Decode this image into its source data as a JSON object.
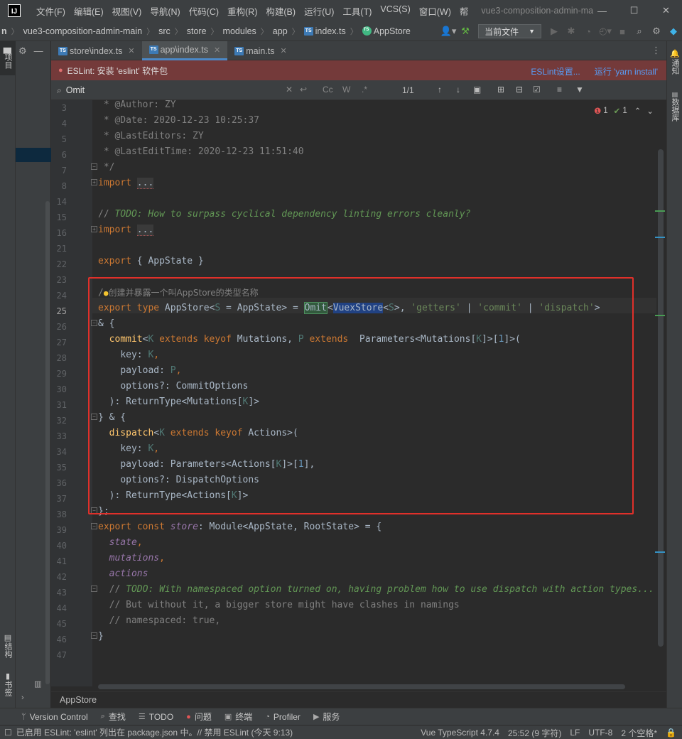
{
  "app": {
    "logo": "IJ",
    "window_title": "vue3-composition-admin-ma",
    "menu": [
      "文件(F)",
      "编辑(E)",
      "视图(V)",
      "导航(N)",
      "代码(C)",
      "重构(R)",
      "构建(B)",
      "运行(U)",
      "工具(T)",
      "VCS(S)",
      "窗口(W)",
      "帮"
    ]
  },
  "breadcrumbs": [
    "n",
    "vue3-composition-admin-main",
    "src",
    "store",
    "modules",
    "app",
    "index.ts",
    "AppStore"
  ],
  "run_config": "当前文件",
  "side_tabs": {
    "left_top": "项目",
    "left_mid": "结构",
    "left_bottom": "书签",
    "right_top": "通知",
    "right_mid": "数据库"
  },
  "tabs": [
    {
      "label": "store\\index.ts",
      "active": false
    },
    {
      "label": "app\\index.ts",
      "active": true
    },
    {
      "label": "main.ts",
      "active": false
    }
  ],
  "eslint_banner": {
    "message": "ESLint: 安装 'eslint' 软件包",
    "settings_link": "ESLint设置...",
    "run_link": "运行 'yarn install'"
  },
  "search": {
    "query": "Omit",
    "count": "1/1",
    "opt_case": "Cc",
    "opt_word": "W",
    "opt_regex": ".*"
  },
  "inspections": {
    "errors": "1",
    "passed": "1"
  },
  "code": {
    "l3": " * @Author: ZY",
    "l4": " * @Date: 2020-12-23 10:25:37",
    "l5": " * @LastEditors: ZY",
    "l6": " * @LastEditTime: 2020-12-23 11:51:40",
    "l7": " */",
    "import_kw": "import",
    "fold_dots": "...",
    "todo1_prefix": "// ",
    "todo1": "TODO: How to surpass cyclical dependency linting errors cleanly?",
    "export_kw": "export",
    "appstate_export": " { AppState }",
    "comment24_prefix": "/",
    "comment24": "创建并暴露一个叫AppStore的类型名称",
    "l25_type": "type",
    "l25_name": " AppStore<",
    "l25_S": "S",
    "l25_eq": " = AppState> = ",
    "l25_omit": "Omit",
    "l25_lt": "<",
    "l25_vuex": "VuexStore",
    "l25_S2": "S",
    "l25_rest": ">, ",
    "l25_getters": "'getters'",
    "l25_pipe": " | ",
    "l25_commit": "'commit'",
    "l25_dispatch": "'dispatch'",
    "l25_end": ">",
    "l26": "& {",
    "l27_fn": "commit",
    "l27_lt": "<",
    "l27_K": "K",
    "l27_ext": " extends ",
    "l27_keyof": "keyof",
    "l27_mut": " Mutations, ",
    "l27_P": "P",
    "l27_params": " Parameters<Mutations[",
    "l27_K2": "K",
    "l27_idx": "]>[",
    "l27_one": "1",
    "l27_end": "]>(",
    "key_label": "key: ",
    "K": "K",
    "comma": ",",
    "payload_label": "payload: ",
    "P": "P",
    "l30": "options?: CommitOptions",
    "l31_a": "): ReturnType<Mutations[",
    "l31_b": "]>",
    "l32": "} & {",
    "l33_fn": "dispatch",
    "l33_act": " Actions>(",
    "l35_a": "Parameters<Actions[",
    "l35_b": "]>[",
    "l35_one": "1",
    "l35_c": "],",
    "l36": "options?: DispatchOptions",
    "l37_a": "): ReturnType<Actions[",
    "l37_b": "]>",
    "l38": "};",
    "l39_const": " const ",
    "l39_store": "store",
    "l39_rest": ": Module<AppState, RootState> = {",
    "state": "state",
    "mutations": "mutations",
    "actions": "actions",
    "todo2_prefix": "// ",
    "todo2": "TODO: With namespaced option turned on, having problem how to use dispatch with action types...",
    "l44": "// But without it, a bigger store might have clashes in namings",
    "l45": "// namespaced: true,",
    "l46": "}"
  },
  "code_crumb": "AppStore",
  "tool_windows": [
    "Version Control",
    "查找",
    "TODO",
    "问题",
    "终端",
    "Profiler",
    "服务"
  ],
  "status": {
    "message": "已启用 ESLint: 'eslint' 列出在 package.json 中。// 禁用 ESLint (今天 9:13)",
    "lang": "Vue TypeScript 4.7.4",
    "position": "25:52 (9 字符)",
    "line_sep": "LF",
    "encoding": "UTF-8",
    "indent": "2 个空格*"
  },
  "colors": {
    "accent": "#4a88c7",
    "error_banner": "#743a3a",
    "highlight_box": "#e0302a"
  }
}
